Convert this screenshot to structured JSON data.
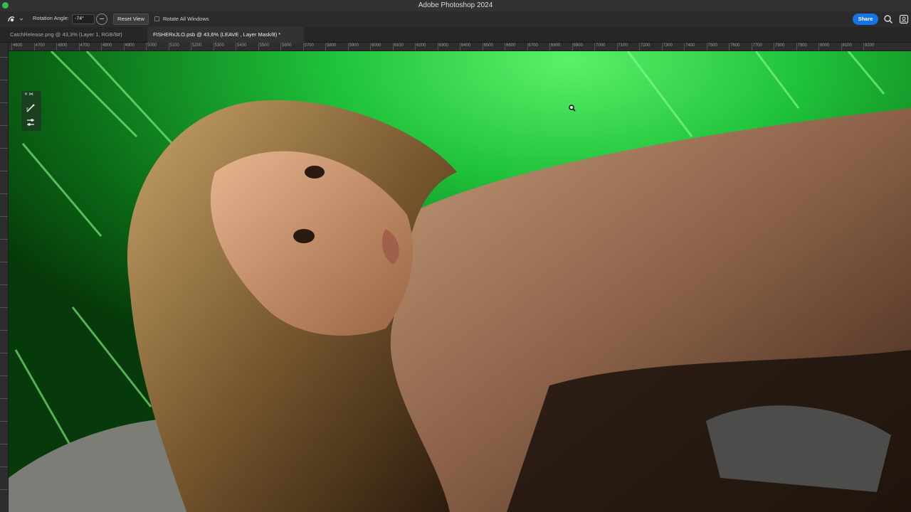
{
  "app_title": "Adobe Photoshop 2024",
  "options_bar": {
    "rotation_label": "Rotation Angle:",
    "rotation_value": "-74°",
    "reset_view": "Reset View",
    "rotate_all": "Rotate All Windows",
    "share": "Share"
  },
  "tabs": [
    {
      "label": "CatchRelease.png @ 43,3% (Layer 1, RGB/8#)"
    },
    {
      "label": "FISHERxJLO.psb @ 43,6% (LEAVE , Layer Mask/8) *"
    }
  ],
  "ruler_h_labels": [
    "4600",
    "4700",
    "4800",
    "4700",
    "4800",
    "4900",
    "5000",
    "5100",
    "5200",
    "5300",
    "5400",
    "5500",
    "5600",
    "5700",
    "5800",
    "5900",
    "6000",
    "6100",
    "6200",
    "6300",
    "6400",
    "6500",
    "6600",
    "6700",
    "6800",
    "6900",
    "7000",
    "7100",
    "7200",
    "7300",
    "7400",
    "7500",
    "7600",
    "7700",
    "7800",
    "7900",
    "8000",
    "8100",
    "8200"
  ],
  "icons": {
    "tool": "rotate-view-tool-icon",
    "dial": "angle-dial-icon",
    "search": "search-icon",
    "help": "help-icon",
    "brush": "brush-icon",
    "adjust": "sliders-icon",
    "cursor": "rotate-cursor-icon"
  },
  "colors": {
    "accent": "#1473e6",
    "background_green": "#1fc23a"
  }
}
